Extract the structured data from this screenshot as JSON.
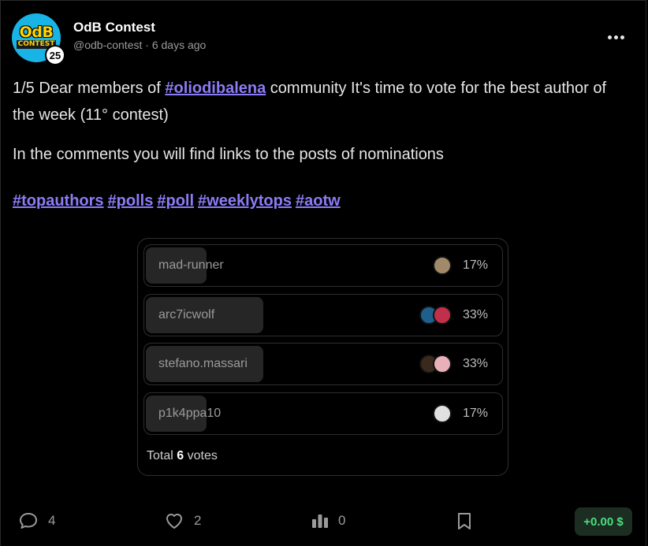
{
  "post": {
    "avatar_line1": "OdB",
    "avatar_line2": "CONTEST",
    "reputation": "25",
    "author_name": "OdB Contest",
    "author_handle": "@odb-contest",
    "separator": "·",
    "time_ago": "6 days ago",
    "body_line1_before": "1/5 Dear members of ",
    "body_link": "#oliodibalena",
    "body_line1_after": " community It's time to vote for the best author of the week (11° contest)",
    "body_para2": "In the comments you will find links to the posts of nominations",
    "tags": [
      "#topauthors",
      "#polls",
      "#poll",
      "#weeklytops",
      "#aotw"
    ]
  },
  "poll": {
    "options": [
      {
        "name": "mad-runner",
        "percent_label": "17%",
        "percent": 17,
        "voter_colors": [
          "#a08a6a"
        ]
      },
      {
        "name": "arc7icwolf",
        "percent_label": "33%",
        "percent": 33,
        "voter_colors": [
          "#1f5f8b",
          "#c0304a"
        ]
      },
      {
        "name": "stefano.massari",
        "percent_label": "33%",
        "percent": 33,
        "voter_colors": [
          "#3a2a1e",
          "#e8b0b8"
        ]
      },
      {
        "name": "p1k4ppa10",
        "percent_label": "17%",
        "percent": 17,
        "voter_colors": [
          "#e0e0e0"
        ]
      }
    ],
    "total_prefix": "Total",
    "total_count": "6",
    "total_suffix": "votes"
  },
  "actions": {
    "comments_icon": "comment-icon",
    "comments_count": "4",
    "likes_icon": "heart-icon",
    "likes_count": "2",
    "stats_icon": "bar-chart-icon",
    "stats_count": "0",
    "bookmark_icon": "bookmark-icon",
    "payout": "+0.00 $"
  },
  "colors": {
    "link": "#8b7cf6",
    "payout_text": "#4ade80",
    "payout_bg": "#1c2e22",
    "avatar_bg": "#18b4e6"
  }
}
